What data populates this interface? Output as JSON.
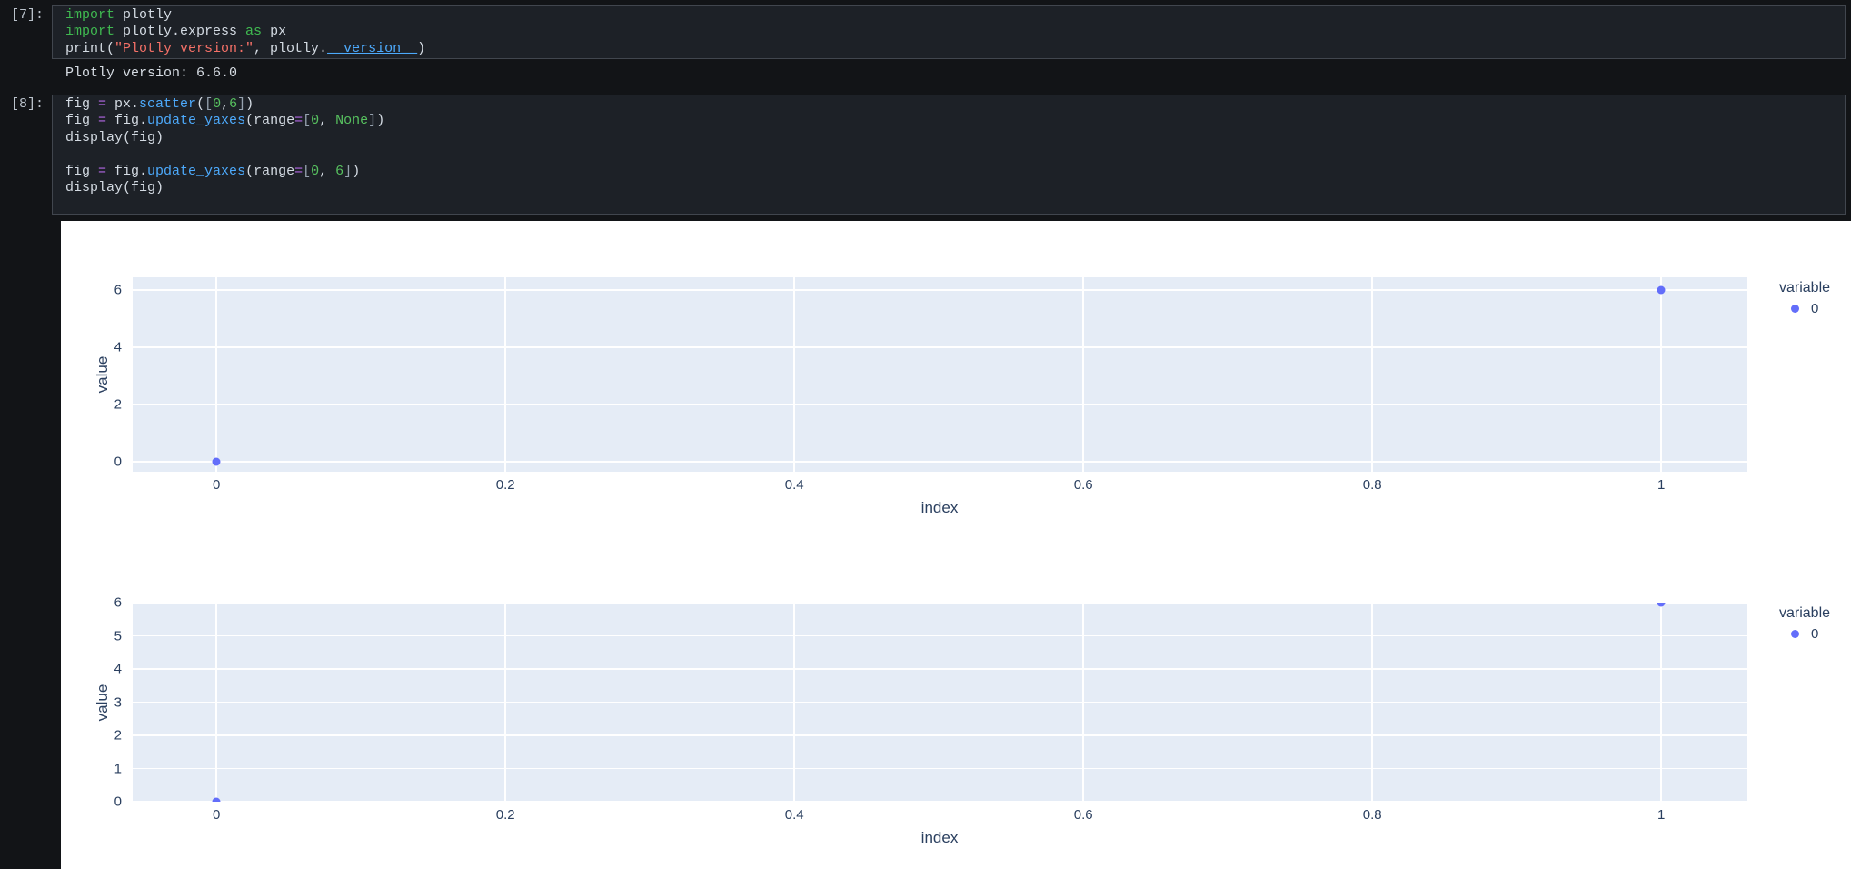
{
  "colors": {
    "page_bg": "#121417",
    "cell_bg": "#1d2127",
    "cell_border": "#41464e",
    "canvas_bg": "#ffffff",
    "plot_bg": "#e5ecf6",
    "gridline": "#ffffff",
    "marker": "#636efa",
    "axis_text": "#2a3f5f",
    "keyword_green": "#3fb950",
    "string_red": "#f47067",
    "function_blue": "#4daafc",
    "operator_purple": "#b267e6"
  },
  "notebook": {
    "cells": [
      {
        "execution_label": "[7]:",
        "lines": [
          [
            [
              "kw",
              "import"
            ],
            [
              "pln",
              " plotly"
            ]
          ],
          [
            [
              "kw",
              "import"
            ],
            [
              "pln",
              " plotly.express "
            ],
            [
              "kw",
              "as"
            ],
            [
              "pln",
              " px"
            ]
          ],
          [
            [
              "pln",
              "print("
            ],
            [
              "str",
              "\"Plotly version:\""
            ],
            [
              "pln",
              ", plotly."
            ],
            [
              "fnu",
              "__version__"
            ],
            [
              "pln",
              ")"
            ]
          ]
        ],
        "output_text": "Plotly version: 6.6.0"
      },
      {
        "execution_label": "[8]:",
        "lines": [
          [
            [
              "pln",
              "fig "
            ],
            [
              "op",
              "="
            ],
            [
              "pln",
              " px."
            ],
            [
              "fn",
              "scatter"
            ],
            [
              "pln",
              "("
            ],
            [
              "brk",
              "["
            ],
            [
              "num",
              "0"
            ],
            [
              "pln",
              ","
            ],
            [
              "num",
              "6"
            ],
            [
              "brk",
              "]"
            ],
            [
              "pln",
              ")"
            ]
          ],
          [
            [
              "pln",
              "fig "
            ],
            [
              "op",
              "="
            ],
            [
              "pln",
              " fig."
            ],
            [
              "fn",
              "update_yaxes"
            ],
            [
              "pln",
              "(range"
            ],
            [
              "op",
              "="
            ],
            [
              "brk",
              "["
            ],
            [
              "num",
              "0"
            ],
            [
              "pln",
              ", "
            ],
            [
              "num",
              "None"
            ],
            [
              "brk",
              "]"
            ],
            [
              "pln",
              ")"
            ]
          ],
          [
            [
              "pln",
              "display(fig)"
            ]
          ],
          [],
          [
            [
              "pln",
              "fig "
            ],
            [
              "op",
              "="
            ],
            [
              "pln",
              " fig."
            ],
            [
              "fn",
              "update_yaxes"
            ],
            [
              "pln",
              "(range"
            ],
            [
              "op",
              "="
            ],
            [
              "brk",
              "["
            ],
            [
              "num",
              "0"
            ],
            [
              "pln",
              ", "
            ],
            [
              "num",
              "6"
            ],
            [
              "brk",
              "]"
            ],
            [
              "pln",
              ")"
            ]
          ],
          [
            [
              "pln",
              "display(fig)"
            ]
          ]
        ],
        "output_text": ""
      }
    ]
  },
  "chart_data": [
    {
      "type": "scatter",
      "title": "",
      "x": [
        0,
        1
      ],
      "series": [
        {
          "name": "0",
          "y": [
            0,
            6
          ],
          "color": "#636efa"
        }
      ],
      "xlabel": "index",
      "ylabel": "value",
      "legend_title": "variable",
      "legend_position": "right",
      "grid": true,
      "plot_bg": "#e5ecf6",
      "marker_color": "#636efa",
      "xlim": [
        -0.058,
        1.059
      ],
      "ylim": [
        -0.35,
        6.44
      ],
      "xticks": [
        0,
        0.2,
        0.4,
        0.6,
        0.8,
        1
      ],
      "xtick_labels": [
        "0",
        "0.2",
        "0.4",
        "0.6",
        "0.8",
        "1"
      ],
      "yticks": [
        0,
        2,
        4,
        6
      ],
      "ytick_labels": [
        "0",
        "2",
        "4",
        "6"
      ]
    },
    {
      "type": "scatter",
      "title": "",
      "x": [
        0,
        1
      ],
      "series": [
        {
          "name": "0",
          "y": [
            0,
            6
          ],
          "color": "#636efa"
        }
      ],
      "xlabel": "index",
      "ylabel": "value",
      "legend_title": "variable",
      "legend_position": "right",
      "grid": true,
      "plot_bg": "#e5ecf6",
      "marker_color": "#636efa",
      "xlim": [
        -0.058,
        1.059
      ],
      "ylim": [
        0,
        6
      ],
      "xticks": [
        0,
        0.2,
        0.4,
        0.6,
        0.8,
        1
      ],
      "xtick_labels": [
        "0",
        "0.2",
        "0.4",
        "0.6",
        "0.8",
        "1"
      ],
      "yticks": [
        0,
        1,
        2,
        3,
        4,
        5,
        6
      ],
      "ytick_labels": [
        "0",
        "1",
        "2",
        "3",
        "4",
        "5",
        "6"
      ]
    }
  ]
}
